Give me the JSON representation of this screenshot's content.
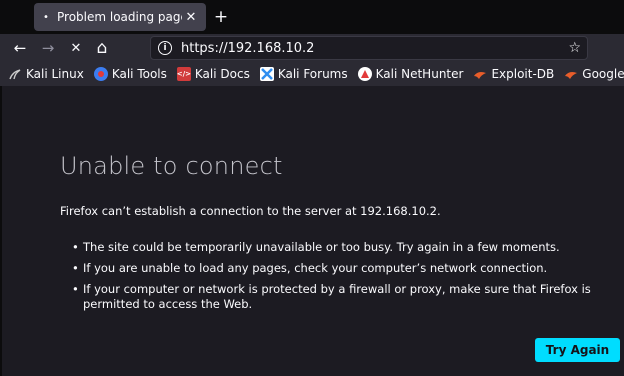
{
  "tab": {
    "title": "Problem loading page",
    "close_glyph": "✕",
    "newtab_glyph": "+"
  },
  "nav": {
    "back_glyph": "←",
    "forward_glyph": "→",
    "stop_glyph": "✕",
    "home_glyph": "⌂",
    "url": "https://192.168.10.2",
    "info_glyph": "i",
    "star_glyph": "☆"
  },
  "bookmarks": [
    {
      "label": "Kali Linux",
      "icon": "kali-dragon-icon",
      "icon_color": "#cccccc"
    },
    {
      "label": "Kali Tools",
      "icon": "kali-tools-icon",
      "icon_color": "#3c7df0"
    },
    {
      "label": "Kali Docs",
      "icon": "kali-docs-icon",
      "icon_color": "#d13b3b"
    },
    {
      "label": "Kali Forums",
      "icon": "kali-forums-icon",
      "icon_color": "#2f8ef0"
    },
    {
      "label": "Kali NetHunter",
      "icon": "nethunter-icon",
      "icon_color": "#e23a3a"
    },
    {
      "label": "Exploit-DB",
      "icon": "exploit-db-icon",
      "icon_color": "#e85d2a"
    },
    {
      "label": "Google Hacking DB",
      "icon": "ghdb-icon",
      "icon_color": "#e85d2a"
    }
  ],
  "error": {
    "title": "Unable to connect",
    "description": "Firefox can’t establish a connection to the server at 192.168.10.2.",
    "bullets": [
      "The site could be temporarily unavailable or too busy. Try again in a few moments.",
      "If you are unable to load any pages, check your computer’s network connection.",
      "If your computer or network is protected by a firewall or proxy, make sure that Firefox is permitted to access the Web."
    ],
    "try_again_label": "Try Again"
  },
  "colors": {
    "accent": "#00ddff",
    "background": "#1c1b22",
    "toolbar": "#2b2a33"
  }
}
